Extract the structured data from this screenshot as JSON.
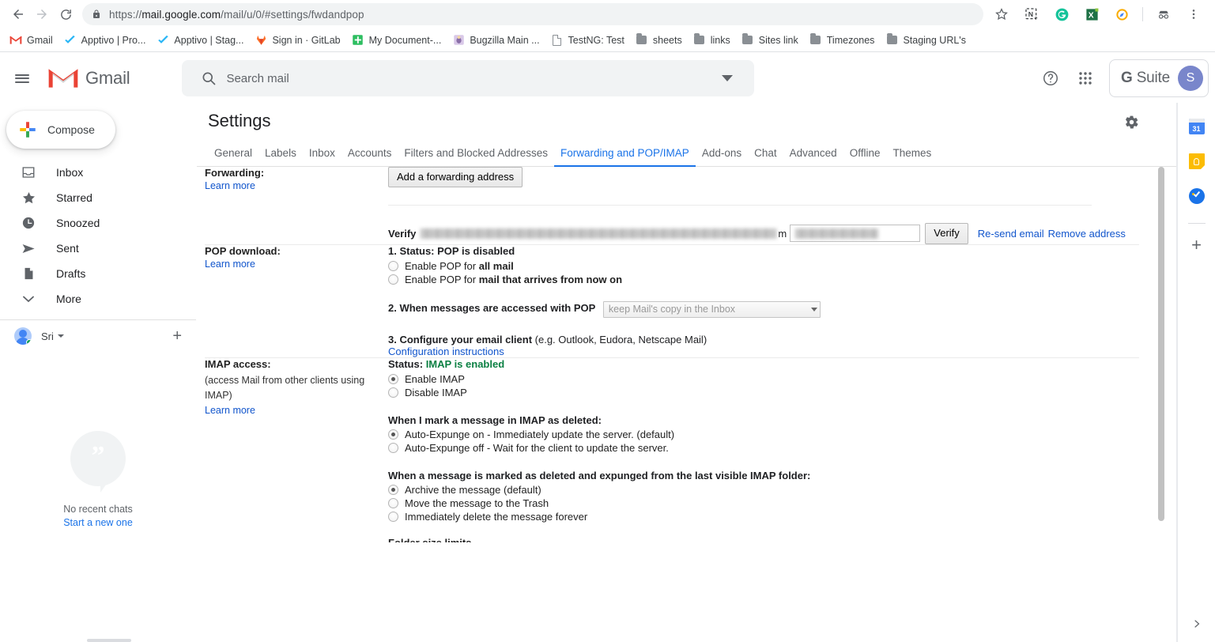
{
  "browser": {
    "url_prefix": "https://",
    "url_domain": "mail.google.com",
    "url_path": "/mail/u/0/#settings/fwdandpop",
    "nav": {
      "back": "back-arrow",
      "forward": "forward-arrow",
      "reload": "reload"
    },
    "toolbar_icons": [
      "star-icon",
      "onenote-clipper-icon",
      "grammarly-icon",
      "excel-icon",
      "compass-extension-icon",
      "incognito-icon",
      "chrome-menu-icon"
    ],
    "bookmarks": [
      {
        "label": "Gmail",
        "icon": "gmail-icon"
      },
      {
        "label": "Apptivo | Pro...",
        "icon": "apptivo-icon"
      },
      {
        "label": "Apptivo | Stag...",
        "icon": "apptivo-icon"
      },
      {
        "label": "Sign in · GitLab",
        "icon": "gitlab-icon"
      },
      {
        "label": "My Document-...",
        "icon": "evernote-icon"
      },
      {
        "label": "Bugzilla Main ...",
        "icon": "bugzilla-icon"
      },
      {
        "label": "TestNG: Test",
        "icon": "document-icon"
      },
      {
        "label": "sheets",
        "icon": "folder-icon"
      },
      {
        "label": "links",
        "icon": "folder-icon"
      },
      {
        "label": "Sites link",
        "icon": "folder-icon"
      },
      {
        "label": "Timezones",
        "icon": "folder-icon"
      },
      {
        "label": "Staging URL's",
        "icon": "folder-icon"
      }
    ]
  },
  "app_header": {
    "menu_icon": "hamburger-icon",
    "logo_text": "Gmail",
    "search_placeholder": "Search mail",
    "search_value": "",
    "search_icon": "search-icon",
    "search_options_icon": "chevron-down-icon",
    "help_icon": "help-icon",
    "apps_icon": "apps-grid-icon",
    "account_chip_brand_g": "G",
    "account_chip_brand": " Suite",
    "avatar_initial": "S"
  },
  "sidebar": {
    "compose_label": "Compose",
    "items": [
      {
        "label": "Inbox",
        "icon": "inbox-icon"
      },
      {
        "label": "Starred",
        "icon": "star-icon"
      },
      {
        "label": "Snoozed",
        "icon": "clock-icon"
      },
      {
        "label": "Sent",
        "icon": "send-icon"
      },
      {
        "label": "Drafts",
        "icon": "draft-icon"
      },
      {
        "label": "More",
        "icon": "chevron-down-icon"
      }
    ],
    "account": {
      "name": "Sri",
      "add_label": "+"
    },
    "hangouts": {
      "empty_text": "No recent chats",
      "start_link": "Start a new one"
    }
  },
  "settings": {
    "title": "Settings",
    "gear_icon": "gear-icon",
    "tabs": [
      {
        "label": "General",
        "active": false
      },
      {
        "label": "Labels",
        "active": false
      },
      {
        "label": "Inbox",
        "active": false
      },
      {
        "label": "Accounts",
        "active": false
      },
      {
        "label": "Filters and Blocked Addresses",
        "active": false
      },
      {
        "label": "Forwarding and POP/IMAP",
        "active": true
      },
      {
        "label": "Add-ons",
        "active": false
      },
      {
        "label": "Chat",
        "active": false
      },
      {
        "label": "Advanced",
        "active": false
      },
      {
        "label": "Offline",
        "active": false
      },
      {
        "label": "Themes",
        "active": false
      }
    ],
    "forwarding": {
      "label": "Forwarding:",
      "learn_more": "Learn more",
      "add_address_button": "Add a forwarding address",
      "verify_prefix": "Verify",
      "verify_redacted_email": "",
      "verify_tail": "m",
      "verify_code_value": "",
      "verify_button": "Verify",
      "resend_link": "Re-send email",
      "remove_link": "Remove address"
    },
    "pop": {
      "label": "POP download:",
      "learn_more": "Learn more",
      "step1_prefix": "1. Status:",
      "step1_status": "POP is disabled",
      "options": [
        {
          "pre": "Enable POP for ",
          "strong": "all mail",
          "checked": false
        },
        {
          "pre": "Enable POP for ",
          "strong": "mail that arrives from now on",
          "checked": false
        }
      ],
      "step2_label": "2. When messages are accessed with POP",
      "step2_select_value": "keep Mail's copy in the Inbox",
      "step3_bold": "3. Configure your email client",
      "step3_reg": " (e.g. Outlook, Eudora, Netscape Mail)",
      "config_link": "Configuration instructions"
    },
    "imap": {
      "label": "IMAP access:",
      "note": "(access Mail from other clients using IMAP)",
      "learn_more": "Learn more",
      "status_prefix": "Status:",
      "status_value": "IMAP is enabled",
      "status_color": "#0b8043",
      "enable_options": [
        {
          "label": "Enable IMAP",
          "checked": true
        },
        {
          "label": "Disable IMAP",
          "checked": false
        }
      ],
      "expunge_title": "When I mark a message in IMAP as deleted:",
      "expunge_options": [
        {
          "label": "Auto-Expunge on - Immediately update the server. (default)",
          "checked": true
        },
        {
          "label": "Auto-Expunge off - Wait for the client to update the server.",
          "checked": false
        }
      ],
      "folder_title": "When a message is marked as deleted and expunged from the last visible IMAP folder:",
      "folder_options": [
        {
          "label": "Archive the message (default)",
          "checked": true
        },
        {
          "label": "Move the message to the Trash",
          "checked": false
        },
        {
          "label": "Immediately delete the message forever",
          "checked": false
        }
      ],
      "cut_off_title": "Folder size limits"
    }
  },
  "side_panel": {
    "items": [
      {
        "icon": "calendar-icon",
        "badge": "31"
      },
      {
        "icon": "keep-icon"
      },
      {
        "icon": "tasks-icon"
      }
    ],
    "add_label": "+",
    "expand_icon": "chevron-right-icon"
  }
}
